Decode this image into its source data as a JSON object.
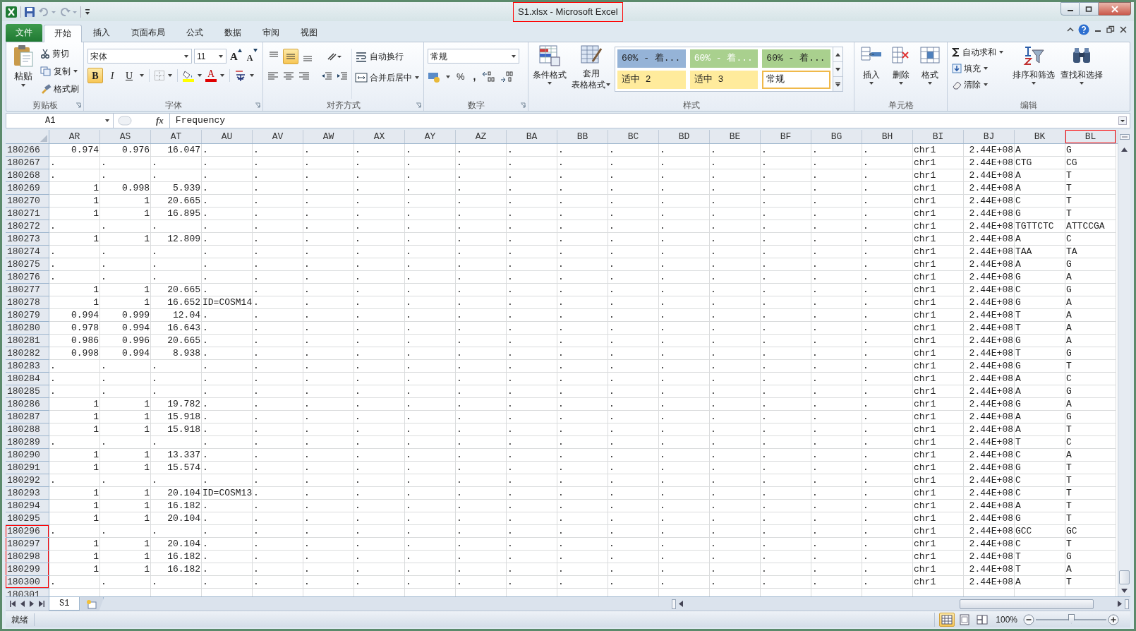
{
  "window": {
    "title": "S1.xlsx - Microsoft Excel",
    "title_highlighted": true
  },
  "tabs": [
    {
      "label": "文件",
      "kind": "file",
      "selected": false
    },
    {
      "label": "开始",
      "kind": "tab",
      "selected": true
    },
    {
      "label": "插入",
      "kind": "tab",
      "selected": false
    },
    {
      "label": "页面布局",
      "kind": "tab",
      "selected": false
    },
    {
      "label": "公式",
      "kind": "tab",
      "selected": false
    },
    {
      "label": "数据",
      "kind": "tab",
      "selected": false
    },
    {
      "label": "审阅",
      "kind": "tab",
      "selected": false
    },
    {
      "label": "视图",
      "kind": "tab",
      "selected": false
    }
  ],
  "clipboard": {
    "label": "剪贴板",
    "paste": "粘贴",
    "cut": "剪切",
    "copy": "复制",
    "format_painter": "格式刷"
  },
  "font": {
    "label": "字体",
    "name": "宋体",
    "size": "11",
    "grow": "A",
    "shrink": "A",
    "font_color": "A",
    "styles": [
      {
        "label": "B",
        "kind": "bold",
        "selected": true
      },
      {
        "label": "I",
        "kind": "italic",
        "selected": false
      },
      {
        "label": "U",
        "kind": "underline",
        "selected": false
      }
    ]
  },
  "alignment": {
    "label": "对齐方式",
    "wrap": "自动换行",
    "merge": "合并后居中",
    "middle_selected": true
  },
  "number": {
    "label": "数字",
    "format": "常规",
    "percent": "%",
    "comma": ","
  },
  "styles": {
    "label": "样式",
    "conditional": "条件格式",
    "table_format": [
      "套用",
      "表格格式"
    ],
    "gallery": [
      {
        "label": "60% - 着...",
        "color": "#95b3d7",
        "light_text": false,
        "selected": false
      },
      {
        "label": "60% - 着...",
        "color": "#a9d08e",
        "light_text": true,
        "selected": false
      },
      {
        "label": "60% - 着...",
        "color": "#a9d08e",
        "light_text": false,
        "selected": false
      },
      {
        "label": "适中 2",
        "color": "#ffeb9c",
        "light_text": false,
        "selected": false
      },
      {
        "label": "适中 3",
        "color": "#ffeb9c",
        "light_text": false,
        "selected": false
      },
      {
        "label": "常规",
        "color": "#ffffff",
        "light_text": false,
        "selected": true
      }
    ]
  },
  "cells": {
    "label": "单元格",
    "insert": "插入",
    "delete": "删除",
    "format": "格式"
  },
  "editing": {
    "label": "编辑",
    "autosum": "自动求和",
    "fill": "填充",
    "clear": "清除",
    "sort": "排序和筛选",
    "find": "查找和选择"
  },
  "formula_bar": {
    "name_box": "A1",
    "fx": "fx",
    "formula": "Frequency"
  },
  "sheet": {
    "columns": [
      {
        "label": "AR",
        "kind": "measure",
        "highlighted": false
      },
      {
        "label": "AS",
        "kind": "measure",
        "highlighted": false
      },
      {
        "label": "AT",
        "kind": "measure",
        "highlighted": false
      },
      {
        "label": "AU",
        "kind": "text",
        "highlighted": false
      },
      {
        "label": "AV",
        "kind": "text",
        "highlighted": false
      },
      {
        "label": "AW",
        "kind": "text",
        "highlighted": false
      },
      {
        "label": "AX",
        "kind": "text",
        "highlighted": false
      },
      {
        "label": "AY",
        "kind": "text",
        "highlighted": false
      },
      {
        "label": "AZ",
        "kind": "text",
        "highlighted": false
      },
      {
        "label": "BA",
        "kind": "text",
        "highlighted": false
      },
      {
        "label": "BB",
        "kind": "text",
        "highlighted": false
      },
      {
        "label": "BC",
        "kind": "text",
        "highlighted": false
      },
      {
        "label": "BD",
        "kind": "text",
        "highlighted": false
      },
      {
        "label": "BE",
        "kind": "text",
        "highlighted": false
      },
      {
        "label": "BF",
        "kind": "text",
        "highlighted": false
      },
      {
        "label": "BG",
        "kind": "text",
        "highlighted": false
      },
      {
        "label": "BH",
        "kind": "text",
        "highlighted": false
      },
      {
        "label": "BI",
        "kind": "text",
        "highlighted": false
      },
      {
        "label": "BJ",
        "kind": "number",
        "highlighted": false
      },
      {
        "label": "BK",
        "kind": "text",
        "highlighted": false
      },
      {
        "label": "BL",
        "kind": "text",
        "highlighted": true
      }
    ],
    "rows": [
      {
        "header": "180266",
        "numeric": true,
        "highlighted": false,
        "cells": [
          "0.974",
          "0.976",
          "16.047",
          ".",
          ".",
          ".",
          ".",
          ".",
          ".",
          ".",
          ".",
          ".",
          ".",
          ".",
          ".",
          ".",
          ".",
          "chr1",
          "2.44E+08",
          "A",
          "G"
        ]
      },
      {
        "header": "180267",
        "numeric": false,
        "highlighted": false,
        "cells": [
          ".",
          ".",
          ".",
          ".",
          ".",
          ".",
          ".",
          ".",
          ".",
          ".",
          ".",
          ".",
          ".",
          ".",
          ".",
          ".",
          ".",
          "chr1",
          "2.44E+08",
          "CTG",
          "CG"
        ]
      },
      {
        "header": "180268",
        "numeric": false,
        "highlighted": false,
        "cells": [
          ".",
          ".",
          ".",
          ".",
          ".",
          ".",
          ".",
          ".",
          ".",
          ".",
          ".",
          ".",
          ".",
          ".",
          ".",
          ".",
          ".",
          "chr1",
          "2.44E+08",
          "A",
          "T"
        ]
      },
      {
        "header": "180269",
        "numeric": true,
        "highlighted": false,
        "cells": [
          "1",
          "0.998",
          "5.939",
          ".",
          ".",
          ".",
          ".",
          ".",
          ".",
          ".",
          ".",
          ".",
          ".",
          ".",
          ".",
          ".",
          ".",
          "chr1",
          "2.44E+08",
          "A",
          "T"
        ]
      },
      {
        "header": "180270",
        "numeric": true,
        "highlighted": false,
        "cells": [
          "1",
          "1",
          "20.665",
          ".",
          ".",
          ".",
          ".",
          ".",
          ".",
          ".",
          ".",
          ".",
          ".",
          ".",
          ".",
          ".",
          ".",
          "chr1",
          "2.44E+08",
          "C",
          "T"
        ]
      },
      {
        "header": "180271",
        "numeric": true,
        "highlighted": false,
        "cells": [
          "1",
          "1",
          "16.895",
          ".",
          ".",
          ".",
          ".",
          ".",
          ".",
          ".",
          ".",
          ".",
          ".",
          ".",
          ".",
          ".",
          ".",
          "chr1",
          "2.44E+08",
          "G",
          "T"
        ]
      },
      {
        "header": "180272",
        "numeric": false,
        "highlighted": false,
        "cells": [
          ".",
          ".",
          ".",
          ".",
          ".",
          ".",
          ".",
          ".",
          ".",
          ".",
          ".",
          ".",
          ".",
          ".",
          ".",
          ".",
          ".",
          "chr1",
          "2.44E+08",
          "TGTTCTC",
          "ATTCCGA"
        ]
      },
      {
        "header": "180273",
        "numeric": true,
        "highlighted": false,
        "cells": [
          "1",
          "1",
          "12.809",
          ".",
          ".",
          ".",
          ".",
          ".",
          ".",
          ".",
          ".",
          ".",
          ".",
          ".",
          ".",
          ".",
          ".",
          "chr1",
          "2.44E+08",
          "A",
          "C"
        ]
      },
      {
        "header": "180274",
        "numeric": false,
        "highlighted": false,
        "cells": [
          ".",
          ".",
          ".",
          ".",
          ".",
          ".",
          ".",
          ".",
          ".",
          ".",
          ".",
          ".",
          ".",
          ".",
          ".",
          ".",
          ".",
          "chr1",
          "2.44E+08",
          "TAA",
          "TA"
        ]
      },
      {
        "header": "180275",
        "numeric": false,
        "highlighted": false,
        "cells": [
          ".",
          ".",
          ".",
          ".",
          ".",
          ".",
          ".",
          ".",
          ".",
          ".",
          ".",
          ".",
          ".",
          ".",
          ".",
          ".",
          ".",
          "chr1",
          "2.44E+08",
          "A",
          "G"
        ]
      },
      {
        "header": "180276",
        "numeric": false,
        "highlighted": false,
        "cells": [
          ".",
          ".",
          ".",
          ".",
          ".",
          ".",
          ".",
          ".",
          ".",
          ".",
          ".",
          ".",
          ".",
          ".",
          ".",
          ".",
          ".",
          "chr1",
          "2.44E+08",
          "G",
          "A"
        ]
      },
      {
        "header": "180277",
        "numeric": true,
        "highlighted": false,
        "cells": [
          "1",
          "1",
          "20.665",
          ".",
          ".",
          ".",
          ".",
          ".",
          ".",
          ".",
          ".",
          ".",
          ".",
          ".",
          ".",
          ".",
          ".",
          "chr1",
          "2.44E+08",
          "C",
          "G"
        ]
      },
      {
        "header": "180278",
        "numeric": true,
        "highlighted": false,
        "cells": [
          "1",
          "1",
          "16.652",
          "ID=COSM14",
          ".",
          ".",
          ".",
          ".",
          ".",
          ".",
          ".",
          ".",
          ".",
          ".",
          ".",
          ".",
          ".",
          "chr1",
          "2.44E+08",
          "G",
          "A"
        ]
      },
      {
        "header": "180279",
        "numeric": true,
        "highlighted": false,
        "cells": [
          "0.994",
          "0.999",
          "12.04",
          ".",
          ".",
          ".",
          ".",
          ".",
          ".",
          ".",
          ".",
          ".",
          ".",
          ".",
          ".",
          ".",
          ".",
          "chr1",
          "2.44E+08",
          "T",
          "A"
        ]
      },
      {
        "header": "180280",
        "numeric": true,
        "highlighted": false,
        "cells": [
          "0.978",
          "0.994",
          "16.643",
          ".",
          ".",
          ".",
          ".",
          ".",
          ".",
          ".",
          ".",
          ".",
          ".",
          ".",
          ".",
          ".",
          ".",
          "chr1",
          "2.44E+08",
          "T",
          "A"
        ]
      },
      {
        "header": "180281",
        "numeric": true,
        "highlighted": false,
        "cells": [
          "0.986",
          "0.996",
          "20.665",
          ".",
          ".",
          ".",
          ".",
          ".",
          ".",
          ".",
          ".",
          ".",
          ".",
          ".",
          ".",
          ".",
          ".",
          "chr1",
          "2.44E+08",
          "G",
          "A"
        ]
      },
      {
        "header": "180282",
        "numeric": true,
        "highlighted": false,
        "cells": [
          "0.998",
          "0.994",
          "8.938",
          ".",
          ".",
          ".",
          ".",
          ".",
          ".",
          ".",
          ".",
          ".",
          ".",
          ".",
          ".",
          ".",
          ".",
          "chr1",
          "2.44E+08",
          "T",
          "G"
        ]
      },
      {
        "header": "180283",
        "numeric": false,
        "highlighted": false,
        "cells": [
          ".",
          ".",
          ".",
          ".",
          ".",
          ".",
          ".",
          ".",
          ".",
          ".",
          ".",
          ".",
          ".",
          ".",
          ".",
          ".",
          ".",
          "chr1",
          "2.44E+08",
          "G",
          "T"
        ]
      },
      {
        "header": "180284",
        "numeric": false,
        "highlighted": false,
        "cells": [
          ".",
          ".",
          ".",
          ".",
          ".",
          ".",
          ".",
          ".",
          ".",
          ".",
          ".",
          ".",
          ".",
          ".",
          ".",
          ".",
          ".",
          "chr1",
          "2.44E+08",
          "A",
          "C"
        ]
      },
      {
        "header": "180285",
        "numeric": false,
        "highlighted": false,
        "cells": [
          ".",
          ".",
          ".",
          ".",
          ".",
          ".",
          ".",
          ".",
          ".",
          ".",
          ".",
          ".",
          ".",
          ".",
          ".",
          ".",
          ".",
          "chr1",
          "2.44E+08",
          "A",
          "G"
        ]
      },
      {
        "header": "180286",
        "numeric": true,
        "highlighted": false,
        "cells": [
          "1",
          "1",
          "19.782",
          ".",
          ".",
          ".",
          ".",
          ".",
          ".",
          ".",
          ".",
          ".",
          ".",
          ".",
          ".",
          ".",
          ".",
          "chr1",
          "2.44E+08",
          "G",
          "A"
        ]
      },
      {
        "header": "180287",
        "numeric": true,
        "highlighted": false,
        "cells": [
          "1",
          "1",
          "15.918",
          ".",
          ".",
          ".",
          ".",
          ".",
          ".",
          ".",
          ".",
          ".",
          ".",
          ".",
          ".",
          ".",
          ".",
          "chr1",
          "2.44E+08",
          "A",
          "G"
        ]
      },
      {
        "header": "180288",
        "numeric": true,
        "highlighted": false,
        "cells": [
          "1",
          "1",
          "15.918",
          ".",
          ".",
          ".",
          ".",
          ".",
          ".",
          ".",
          ".",
          ".",
          ".",
          ".",
          ".",
          ".",
          ".",
          "chr1",
          "2.44E+08",
          "A",
          "T"
        ]
      },
      {
        "header": "180289",
        "numeric": false,
        "highlighted": false,
        "cells": [
          ".",
          ".",
          ".",
          ".",
          ".",
          ".",
          ".",
          ".",
          ".",
          ".",
          ".",
          ".",
          ".",
          ".",
          ".",
          ".",
          ".",
          "chr1",
          "2.44E+08",
          "T",
          "C"
        ]
      },
      {
        "header": "180290",
        "numeric": true,
        "highlighted": false,
        "cells": [
          "1",
          "1",
          "13.337",
          ".",
          ".",
          ".",
          ".",
          ".",
          ".",
          ".",
          ".",
          ".",
          ".",
          ".",
          ".",
          ".",
          ".",
          "chr1",
          "2.44E+08",
          "C",
          "A"
        ]
      },
      {
        "header": "180291",
        "numeric": true,
        "highlighted": false,
        "cells": [
          "1",
          "1",
          "15.574",
          ".",
          ".",
          ".",
          ".",
          ".",
          ".",
          ".",
          ".",
          ".",
          ".",
          ".",
          ".",
          ".",
          ".",
          "chr1",
          "2.44E+08",
          "G",
          "T"
        ]
      },
      {
        "header": "180292",
        "numeric": false,
        "highlighted": false,
        "cells": [
          ".",
          ".",
          ".",
          ".",
          ".",
          ".",
          ".",
          ".",
          ".",
          ".",
          ".",
          ".",
          ".",
          ".",
          ".",
          ".",
          ".",
          "chr1",
          "2.44E+08",
          "C",
          "T"
        ]
      },
      {
        "header": "180293",
        "numeric": true,
        "highlighted": false,
        "cells": [
          "1",
          "1",
          "20.104",
          "ID=COSM13",
          ".",
          ".",
          ".",
          ".",
          ".",
          ".",
          ".",
          ".",
          ".",
          ".",
          ".",
          ".",
          ".",
          "chr1",
          "2.44E+08",
          "C",
          "T"
        ]
      },
      {
        "header": "180294",
        "numeric": true,
        "highlighted": false,
        "cells": [
          "1",
          "1",
          "16.182",
          ".",
          ".",
          ".",
          ".",
          ".",
          ".",
          ".",
          ".",
          ".",
          ".",
          ".",
          ".",
          ".",
          ".",
          "chr1",
          "2.44E+08",
          "A",
          "T"
        ]
      },
      {
        "header": "180295",
        "numeric": true,
        "highlighted": false,
        "cells": [
          "1",
          "1",
          "20.104",
          ".",
          ".",
          ".",
          ".",
          ".",
          ".",
          ".",
          ".",
          ".",
          ".",
          ".",
          ".",
          ".",
          ".",
          "chr1",
          "2.44E+08",
          "G",
          "T"
        ]
      },
      {
        "header": "180296",
        "numeric": false,
        "highlighted": true,
        "cells": [
          ".",
          ".",
          ".",
          ".",
          ".",
          ".",
          ".",
          ".",
          ".",
          ".",
          ".",
          ".",
          ".",
          ".",
          ".",
          ".",
          ".",
          "chr1",
          "2.44E+08",
          "GCC",
          "GC"
        ]
      },
      {
        "header": "180297",
        "numeric": true,
        "highlighted": true,
        "cells": [
          "1",
          "1",
          "20.104",
          ".",
          ".",
          ".",
          ".",
          ".",
          ".",
          ".",
          ".",
          ".",
          ".",
          ".",
          ".",
          ".",
          ".",
          "chr1",
          "2.44E+08",
          "C",
          "T"
        ]
      },
      {
        "header": "180298",
        "numeric": true,
        "highlighted": true,
        "cells": [
          "1",
          "1",
          "16.182",
          ".",
          ".",
          ".",
          ".",
          ".",
          ".",
          ".",
          ".",
          ".",
          ".",
          ".",
          ".",
          ".",
          ".",
          "chr1",
          "2.44E+08",
          "T",
          "G"
        ]
      },
      {
        "header": "180299",
        "numeric": true,
        "highlighted": true,
        "cells": [
          "1",
          "1",
          "16.182",
          ".",
          ".",
          ".",
          ".",
          ".",
          ".",
          ".",
          ".",
          ".",
          ".",
          ".",
          ".",
          ".",
          ".",
          "chr1",
          "2.44E+08",
          "T",
          "A"
        ]
      },
      {
        "header": "180300",
        "numeric": false,
        "highlighted": true,
        "cells": [
          ".",
          ".",
          ".",
          ".",
          ".",
          ".",
          ".",
          ".",
          ".",
          ".",
          ".",
          ".",
          ".",
          ".",
          ".",
          ".",
          ".",
          "chr1",
          "2.44E+08",
          "A",
          "T"
        ]
      },
      {
        "header": "180301",
        "highlighted": false
      }
    ]
  },
  "sheet_tabs": [
    {
      "label": "S1",
      "selected": true
    }
  ],
  "status_bar": {
    "status": "就绪",
    "views": [
      {
        "kind": "normal",
        "selected": true
      },
      {
        "kind": "page-layout",
        "selected": false
      },
      {
        "kind": "page-break",
        "selected": false
      }
    ],
    "zoom": "100%",
    "zoom_slider": {
      "level": 0.5
    }
  }
}
